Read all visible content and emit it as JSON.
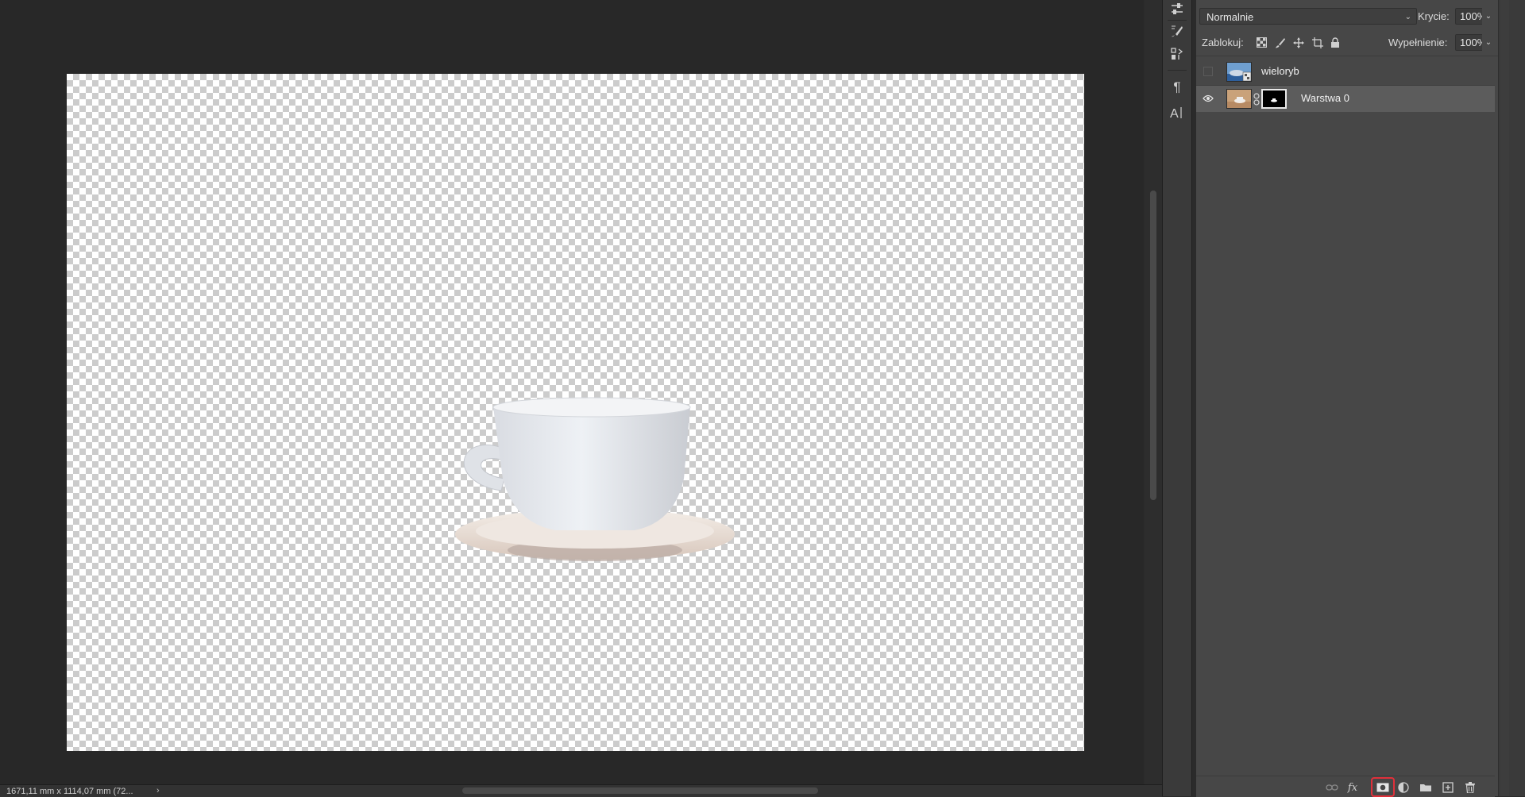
{
  "status_bar": {
    "dimensions": "1671,11 mm x 1114,07 mm (72...",
    "chevron": "›"
  },
  "layers_panel": {
    "blend_mode": "Normalnie",
    "opacity_label": "Krycie:",
    "opacity_value": "100%",
    "lock_label": "Zablokuj:",
    "fill_label": "Wypełnienie:",
    "fill_value": "100%",
    "layers": [
      {
        "name": "wieloryb",
        "visible": false,
        "selected": false,
        "type": "smart-object"
      },
      {
        "name": "Warstwa 0",
        "visible": true,
        "selected": true,
        "has_mask": true
      }
    ]
  },
  "icons": {
    "column": [
      "adjustments-icon",
      "brush-settings-icon",
      "clone-source-icon",
      "paragraph-icon",
      "character-icon"
    ],
    "lock": [
      "lock-transparent-pixels-icon",
      "lock-image-pixels-icon",
      "lock-position-icon",
      "lock-artboard-icon",
      "lock-all-icon"
    ],
    "footer": [
      "link-layers-icon",
      "fx-icon",
      "add-mask-icon",
      "adjustment-layer-icon",
      "new-group-icon",
      "new-layer-icon",
      "delete-layer-icon"
    ]
  },
  "colors": {
    "highlight": "#e0303a",
    "panel_bg": "#474747",
    "selected_row": "#5c5c5c"
  }
}
